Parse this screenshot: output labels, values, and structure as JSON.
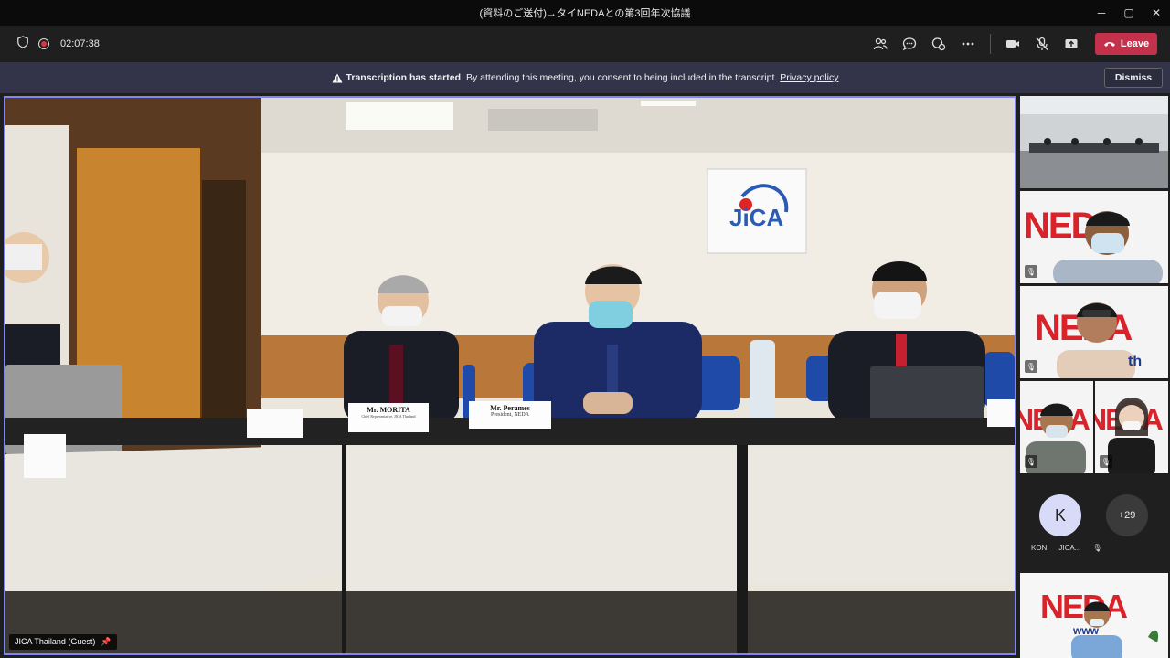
{
  "window": {
    "title": "(資料のご送付)→タイNEDAとの第3回年次協議",
    "minimize": "─",
    "maximize": "▢",
    "close": "✕"
  },
  "toolbar": {
    "timer": "02:07:38",
    "leave_label": "Leave"
  },
  "banner": {
    "title": "Transcription has started",
    "message": "By attending this meeting, you consent to being included in the transcript.",
    "link": "Privacy policy",
    "dismiss_label": "Dismiss"
  },
  "stage": {
    "participant_name": "JICA Thailand (Guest)",
    "logo_text": "JiCA",
    "placards": [
      {
        "name": "Mr. MORITA",
        "role": "Chief Representative, JICA Thailand"
      },
      {
        "name": "Mr. Perames",
        "role": "President, NEDA"
      }
    ]
  },
  "gallery": {
    "neda_text": "NEDA",
    "www_text": "www",
    "th_text": "th",
    "avatar_initial": "K",
    "avatar_names": [
      "KON",
      "JICA..."
    ],
    "more_count": "+29"
  },
  "colors": {
    "accent": "#7f85f5",
    "leave": "#c4314b",
    "banner": "#33344a"
  }
}
